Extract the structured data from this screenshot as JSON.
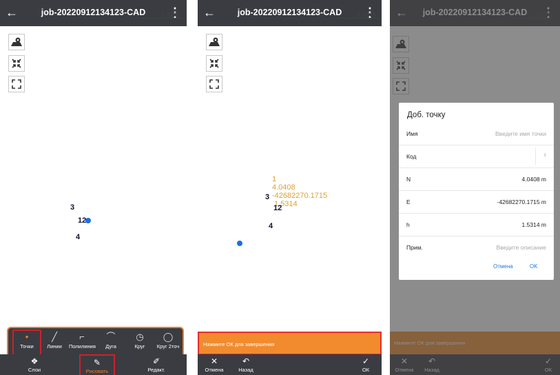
{
  "app": {
    "title": "job-20220912134123-CAD",
    "back_icon": "←",
    "more_icon": "⋮",
    "scale_value": "2.8236"
  },
  "panel1": {
    "map_points": {
      "p3": "3",
      "p12": "12",
      "p4": "4"
    },
    "draw_tools": [
      {
        "label": "Точки",
        "icon": "•"
      },
      {
        "label": "Линии",
        "icon": "╱"
      },
      {
        "label": "Полилиния",
        "icon": "⌐"
      },
      {
        "label": "Дуга",
        "icon": "⌒"
      },
      {
        "label": "Круг",
        "icon": "◷"
      },
      {
        "label": "Круг 2точ",
        "icon": "◯"
      }
    ],
    "bottom": [
      {
        "label": "Слои",
        "icon": "❖"
      },
      {
        "label": "Рисовать",
        "icon": "✎"
      },
      {
        "label": "Редакт.",
        "icon": "✐"
      }
    ]
  },
  "panel2": {
    "map_points": {
      "p3": "3",
      "p12": "12",
      "p4": "4"
    },
    "coord_label": [
      "1",
      "4.0408",
      "-42682270.1715",
      "1.5314"
    ],
    "hint": "Нажмите ОК для завершения",
    "bottom": [
      {
        "label": "Отмена",
        "icon": "✕"
      },
      {
        "label": "Назад",
        "icon": "↶"
      },
      {
        "label": "ОК",
        "icon": "✓"
      }
    ]
  },
  "dialog": {
    "title": "Доб. точку",
    "rows": [
      {
        "key": "Имя",
        "value": "Введите имя точки",
        "placeholder": true
      },
      {
        "key": "Код",
        "value": "",
        "placeholder": true
      },
      {
        "key": "N",
        "value": "4.0408 m",
        "placeholder": false
      },
      {
        "key": "E",
        "value": "-42682270.1715 m",
        "placeholder": false
      },
      {
        "key": "h",
        "value": "1.5314 m",
        "placeholder": false
      },
      {
        "key": "Прим.",
        "value": "Введите описание",
        "placeholder": true
      }
    ],
    "cancel": "Отмена",
    "ok": "OK"
  },
  "colors": {
    "accent": "#f07f2c",
    "highlight": "#d0202a",
    "dark": "#3a3c42",
    "link": "#1e7be0",
    "point": "#1a6fe8"
  }
}
